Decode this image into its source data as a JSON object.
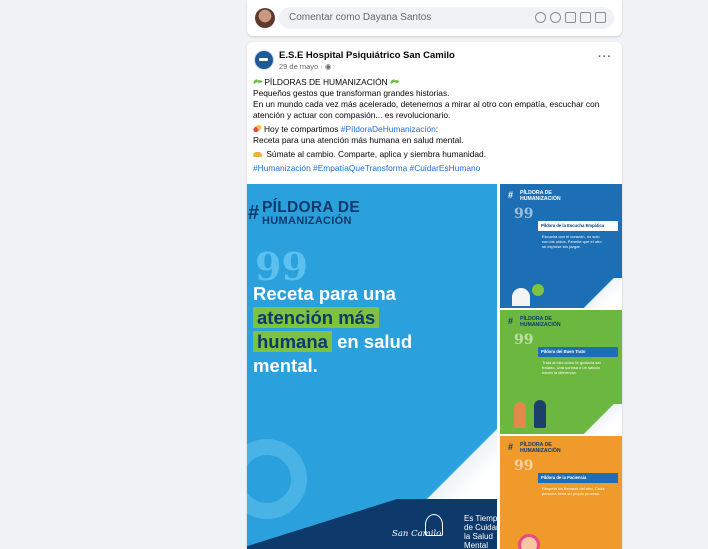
{
  "comment_box": {
    "placeholder": "Comentar como Dayana Santos",
    "icons": [
      "sticker-icon",
      "emoji-icon",
      "camera-icon",
      "gif-icon",
      "sticker-alt-icon"
    ]
  },
  "post": {
    "page_name": "E.S.E Hospital Psiquiátrico San Camilo",
    "date": "29 de mayo · ",
    "privacy_icon": "globe-icon",
    "more_label": "···",
    "lines": {
      "title": "PÍLDORAS DE HUMANIZACIÓN",
      "l1": "Pequeños gestos que transforman grandes historias.",
      "l2": "En un mundo cada vez más acelerado, detenernos a mirar al otro con empatía, escuchar con atención y actuar con compasión... es revolucionario.",
      "l3_prefix": "Hoy te compartimos ",
      "l3_hashtag": "#PíldoraDeHumanización",
      "l3_suffix": ":",
      "l4": "Receta para una atención más humana en salud mental.",
      "l5": "Súmate al cambio. Comparte, aplica y siembra humanidad.",
      "hashtags": "#Humanización #EmpatíaQueTransforma #CuidarEsHumano"
    }
  },
  "main_image": {
    "title": "PÍLDORA DE",
    "subtitle": "HUMANIZACIÓN",
    "quote": "99",
    "headline_1": "Receta para una",
    "headline_hl_1": "atención más",
    "headline_hl_2": "humana",
    "headline_2": " en salud",
    "headline_3": "mental.",
    "footer_name": "San Camilo",
    "footer_slogan": "Es Tiempo\nde Cuidar\nla Salud\nMental"
  },
  "side_images": [
    {
      "title": "PÍLDORA DE\nHUMANIZACIÓN",
      "card_title": "Píldora de la Escucha Empática",
      "card_text": "Escucha con el corazón, no solo con los oídos. Permite que el otro se exprese sin juzgar."
    },
    {
      "title": "PÍLDORA DE\nHUMANIZACIÓN",
      "card_title": "Píldora del Buen Trato",
      "card_text": "Trata al otro como te gustaría ser tratado. Una sonrisa o un saludo hacen la diferencia."
    },
    {
      "title": "PÍLDORA DE\nHUMANIZACIÓN",
      "card_title": "Píldora de la Paciencia",
      "card_text": "Respeta los tiempos del otro. Cada persona tiene su propio proceso."
    }
  ],
  "colors": {
    "accent": "#216fdb",
    "blue": "#2aa0dc",
    "navy": "#0d3a6b",
    "green": "#7fc241",
    "orange": "#f09a2b"
  }
}
